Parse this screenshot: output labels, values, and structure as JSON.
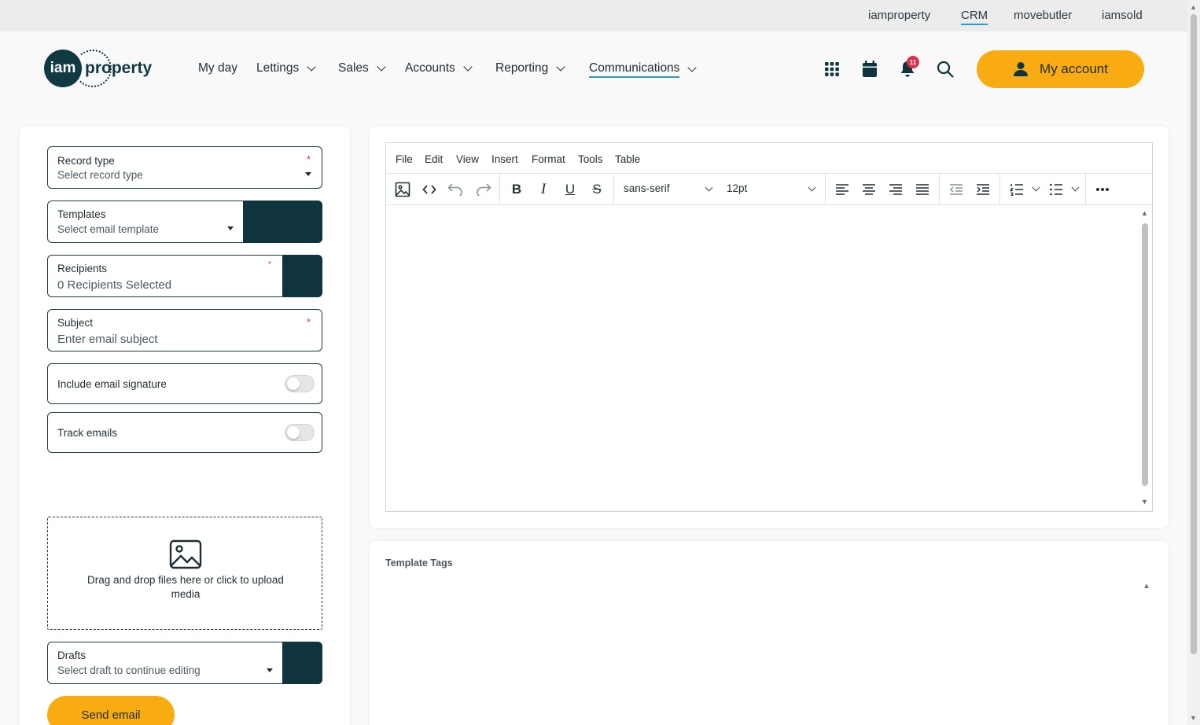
{
  "top_links": [
    {
      "label": "iamproperty",
      "active": false
    },
    {
      "label": "CRM",
      "active": true
    },
    {
      "label": "movebutler",
      "active": false
    },
    {
      "label": "iamsold",
      "active": false
    }
  ],
  "logo": {
    "mark": "iam",
    "word": "property"
  },
  "nav": [
    {
      "label": "My day",
      "dropdown": false
    },
    {
      "label": "Lettings",
      "dropdown": true
    },
    {
      "label": "Sales",
      "dropdown": true
    },
    {
      "label": "Accounts",
      "dropdown": true
    },
    {
      "label": "Reporting",
      "dropdown": true
    },
    {
      "label": "Communications",
      "dropdown": true,
      "active": true
    }
  ],
  "header_icons": [
    "apps-grid-icon",
    "calendar-icon",
    "bell-icon",
    "search-icon"
  ],
  "notifications": {
    "count": "11"
  },
  "account": {
    "label": "My account",
    "icon": "user-icon"
  },
  "form": {
    "record_type": {
      "label": "Record type",
      "value": "Select record type",
      "required_mark": "*"
    },
    "templates": {
      "label": "Templates",
      "value": "Select email template"
    },
    "recipients": {
      "label": "Recipients",
      "value": "0 Recipients Selected",
      "required_mark": "*"
    },
    "subject": {
      "label": "Subject",
      "placeholder": "Enter email subject",
      "required_mark": "*"
    },
    "include_signature": {
      "label": "Include email signature",
      "on": false
    },
    "track_emails": {
      "label": "Track emails",
      "on": false
    },
    "dropzone": {
      "text": "Drag and drop files here or click to upload media",
      "icon": "image-icon"
    },
    "drafts": {
      "label": "Drafts",
      "value": "Select draft to continue editing"
    },
    "send_label": "Send email"
  },
  "editor": {
    "menus": [
      "File",
      "Edit",
      "View",
      "Insert",
      "Format",
      "Tools",
      "Table"
    ],
    "font_family": "sans-serif",
    "font_size": "12pt",
    "tools": [
      "image-icon",
      "code-icon",
      "undo-icon",
      "redo-icon",
      "bold-icon",
      "italic-icon",
      "underline-icon",
      "strikethrough-icon",
      "align-left-icon",
      "align-center-icon",
      "align-right-icon",
      "align-justify-icon",
      "outdent-icon",
      "indent-icon",
      "numbered-list-icon",
      "bullet-list-icon",
      "more-icon"
    ]
  },
  "template_tags": {
    "title": "Template Tags"
  },
  "colors": {
    "accent": "#f9ab12",
    "brand_dark": "#0f343d",
    "link_underline": "#2e9ac9",
    "badge": "#d9334a"
  }
}
